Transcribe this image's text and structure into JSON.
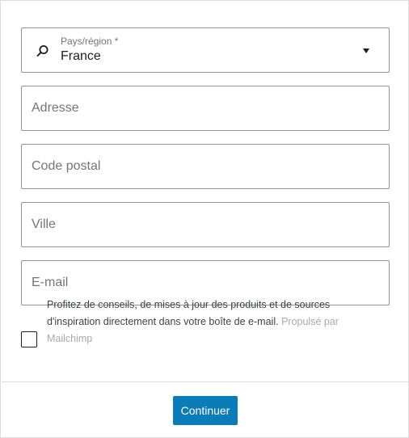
{
  "country": {
    "label": "Pays/région *",
    "value": "France"
  },
  "fields": {
    "address_placeholder": "Adresse",
    "postal_code_placeholder": "Code postal",
    "city_placeholder": "Ville",
    "email_placeholder": "E-mail"
  },
  "consent": {
    "text": "Profitez de conseils, de mises à jour des produits et de sources d'inspiration directement dans votre boîte de e-mail.",
    "powered_by": "Propulsé par Mailchimp",
    "checked": false
  },
  "actions": {
    "continue_label": "Continuer"
  },
  "colors": {
    "accent": "#0a7cb8",
    "border": "#949494",
    "muted_text": "#a7aaad"
  },
  "icons": {
    "country_field": "search-icon",
    "country_dropdown": "caret-down-icon"
  }
}
